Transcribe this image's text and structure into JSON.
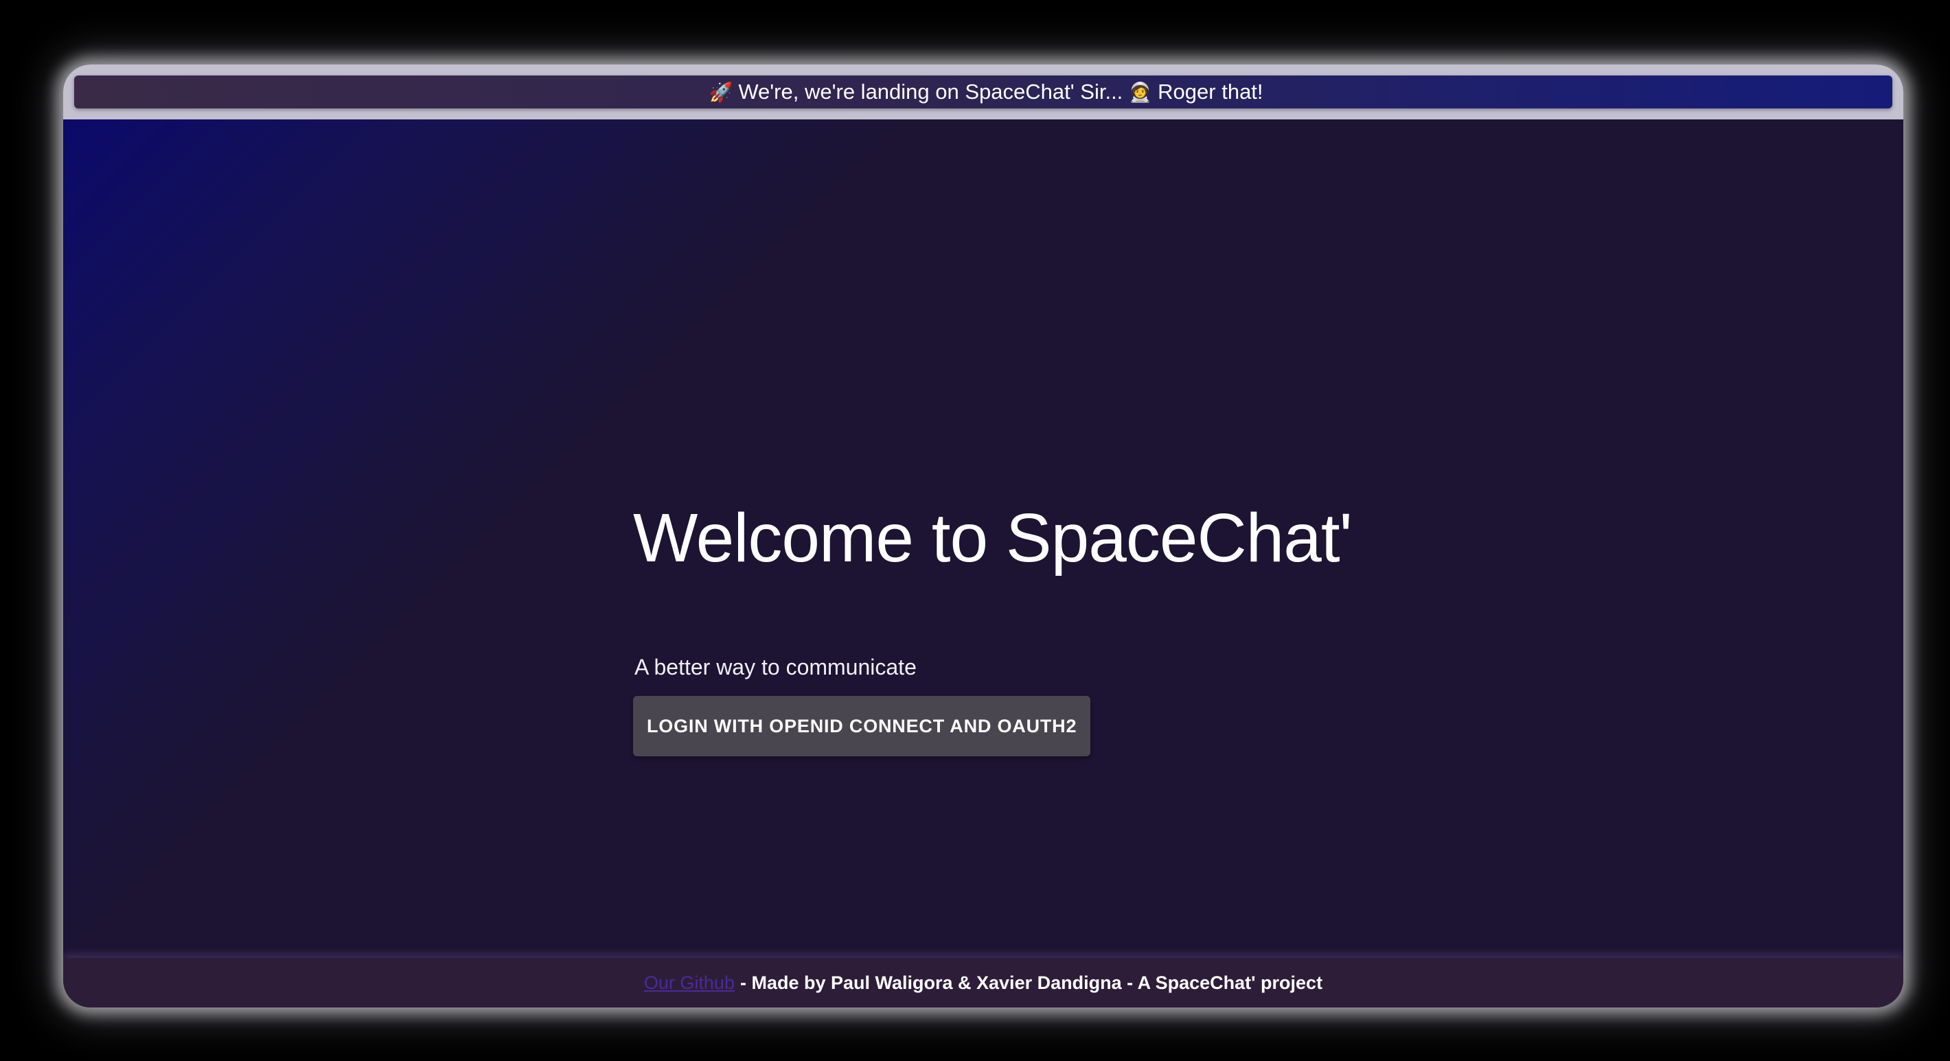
{
  "banner": {
    "rocket_emoji": "🚀",
    "text_part1": "We're, we're landing on SpaceChat' Sir...",
    "astronaut_emoji": "🧑‍🚀",
    "text_part2": "Roger that!"
  },
  "hero": {
    "title": "Welcome to SpaceChat'",
    "subtitle": "A better way to communicate",
    "login_label": "LOGIN WITH OPENID CONNECT AND OAUTH2"
  },
  "footer": {
    "github_link": "Our Github",
    "credits": "- Made by Paul Waligora & Xavier Dandigna - A SpaceChat' project"
  },
  "colors": {
    "background": "#1c1432",
    "gradient_corner": "#0b0a6a",
    "button_bg": "#4a4650",
    "footer_bg": "#2e1d38",
    "link": "#4b2a9a"
  },
  "icons": {
    "rocket": "rocket-icon",
    "astronaut": "astronaut-icon"
  }
}
